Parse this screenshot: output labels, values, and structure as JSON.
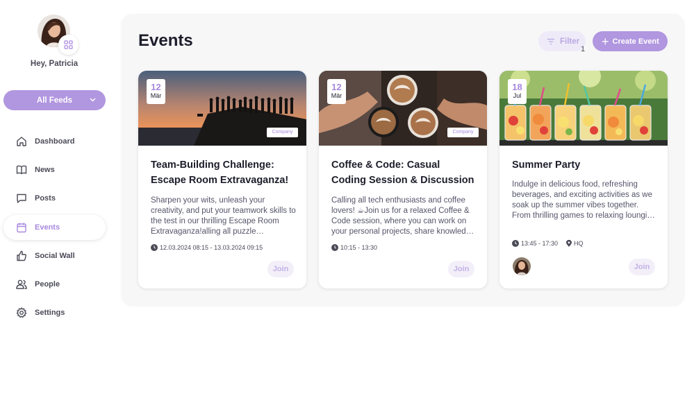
{
  "user": {
    "greeting": "Hey, Patricia"
  },
  "sidebar": {
    "feeds_label": "All Feeds",
    "items": [
      {
        "label": "Dashboard",
        "icon": "home-icon"
      },
      {
        "label": "News",
        "icon": "book-icon"
      },
      {
        "label": "Posts",
        "icon": "chat-icon"
      },
      {
        "label": "Events",
        "icon": "calendar-icon"
      },
      {
        "label": "Social Wall",
        "icon": "thumbs-up-icon"
      },
      {
        "label": "People",
        "icon": "people-icon"
      },
      {
        "label": "Settings",
        "icon": "gear-icon"
      }
    ],
    "active": "Events"
  },
  "header": {
    "title": "Events",
    "filter_label": "Filter",
    "filter_count": "1",
    "create_label": "Create Event"
  },
  "events": [
    {
      "day": "12",
      "month": "Mär",
      "tag": "Company",
      "title": "Team-Building Challenge: Escape Room Extravaganza!",
      "description": "Sharpen your wits, unleash your creativity, and put your teamwork skills to the test in our thrilling Escape Room Extravaganza!alling all puzzle enthusiasts and adventure seekers!",
      "time": "12.03.2024 08:15 - 13.03.2024 09:15",
      "join_label": "Join"
    },
    {
      "day": "12",
      "month": "Mär",
      "tag": "Company",
      "title": "Coffee & Code: Casual Coding Session & Discussion",
      "description": "Calling all tech enthusiasts and coffee lovers! ☕Join us for a relaxed Coffee & Code session, where you can work on your personal projects, share knowledge and learn from each other.",
      "time": "10:15 - 13:30",
      "join_label": "Join"
    },
    {
      "day": "18",
      "month": "Jul",
      "title": "Summer Party",
      "description": "Indulge in delicious food, refreshing beverages, and exciting activities as we soak up the summer vibes together. From thrilling games to relaxing lounging areas, there's something for everyone.",
      "time": "13:45 - 17:30",
      "location": "HQ",
      "join_label": "Join"
    }
  ],
  "colors": {
    "accent": "#b196e0",
    "accent_text": "#a788de",
    "panel": "#f7f7f8"
  }
}
